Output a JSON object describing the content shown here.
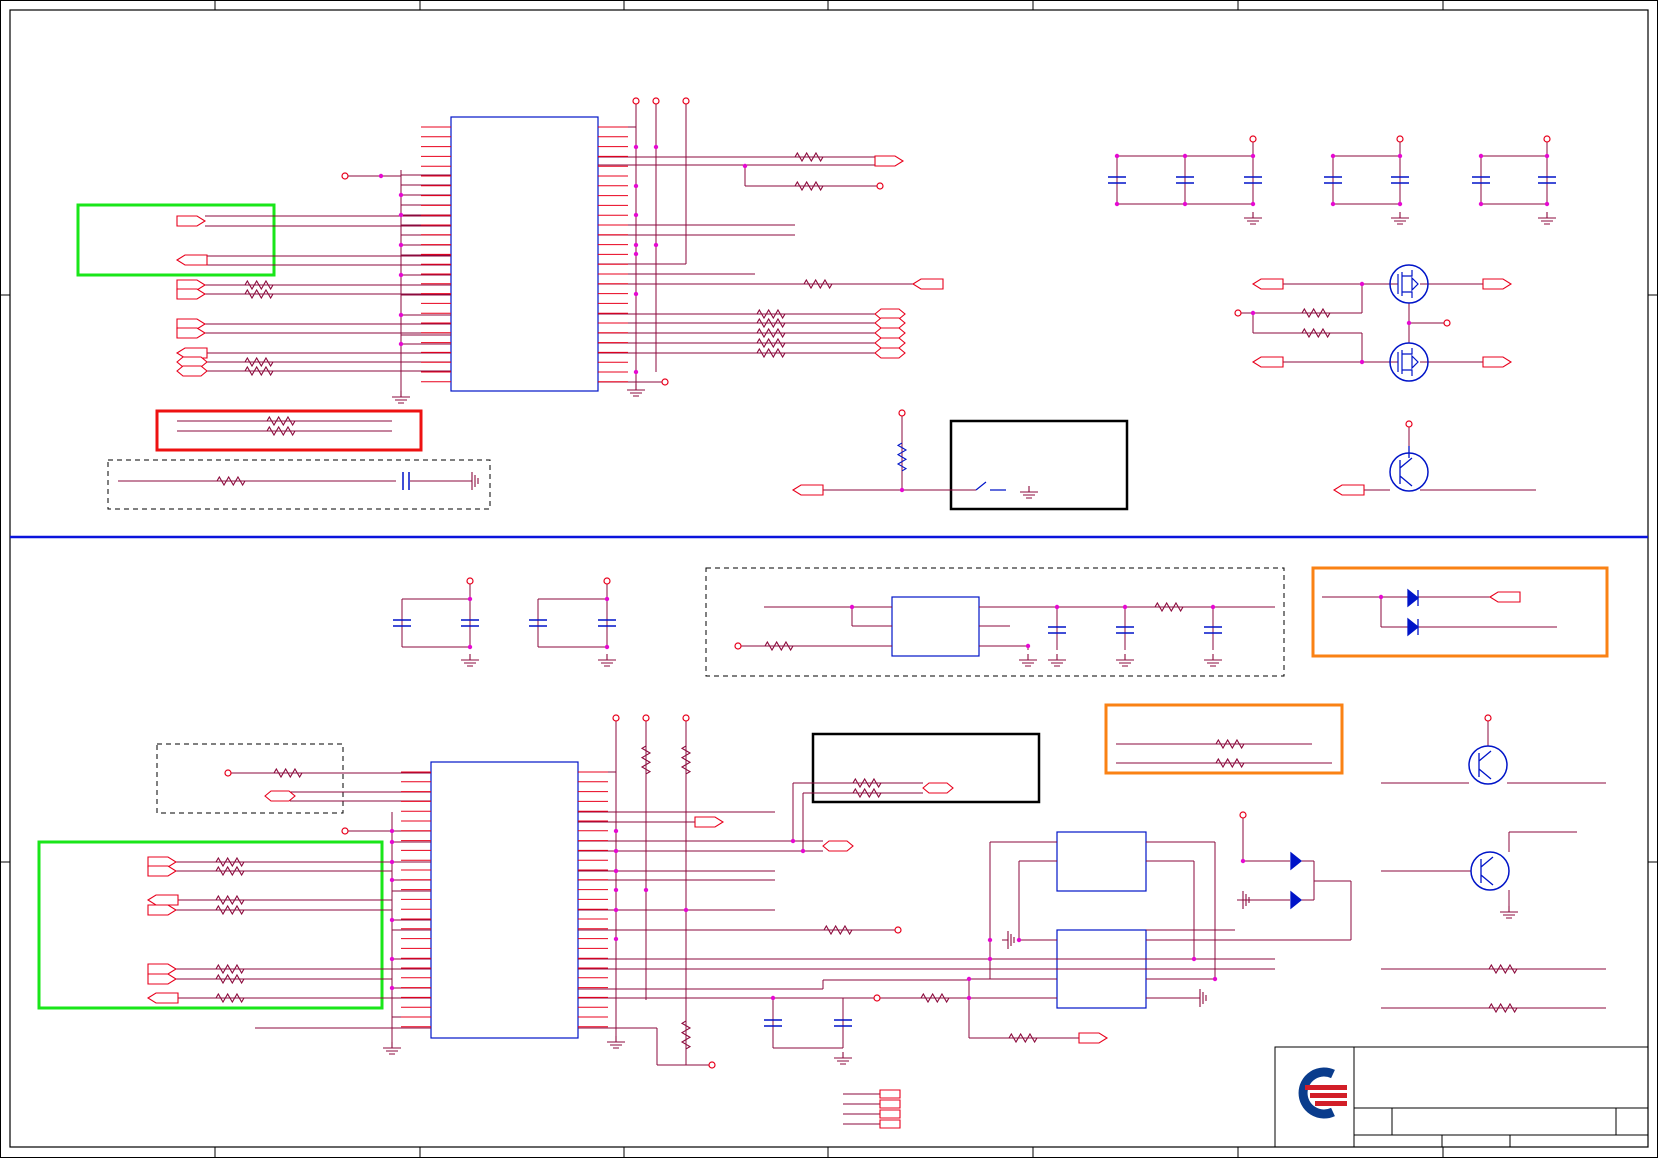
{
  "sheet": {
    "title": "",
    "colors": {
      "wire": "#8b0a3c",
      "pin": "#e8001c",
      "part": "#0014c8",
      "junction": "#e60ad2",
      "frame": "#000000",
      "divider": "#0a14dc",
      "highlight_green": "#19e619",
      "highlight_red": "#ee1111",
      "highlight_orange": "#fa8214",
      "logo_blue": "#0a3c8c",
      "logo_red": "#d21e28"
    },
    "icons": [
      "company-logo-icon",
      "ground-icon",
      "resistor-icon",
      "capacitor-icon",
      "mosfet-icon",
      "transistor-icon",
      "diode-icon",
      "port-connector-icon",
      "power-pin-icon"
    ]
  }
}
